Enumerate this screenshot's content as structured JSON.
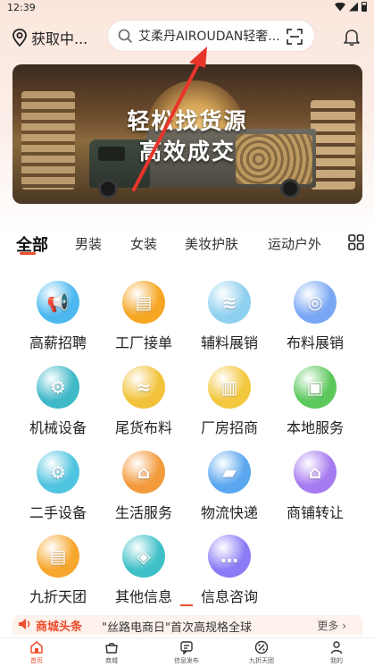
{
  "status_bar": {
    "time": "12:39"
  },
  "header": {
    "location": "获取中...",
    "search_text": "艾柔丹AIROUDAN轻奢..."
  },
  "banner": {
    "line1": "轻松找货源",
    "line2": "高效成交"
  },
  "tabs": [
    {
      "label": "全部"
    },
    {
      "label": "男装"
    },
    {
      "label": "女装"
    },
    {
      "label": "美妆护肤"
    },
    {
      "label": "运动户外"
    }
  ],
  "categories": [
    {
      "label": "高薪招聘",
      "icon": "megaphone-icon",
      "color": "#4db8f0"
    },
    {
      "label": "工厂接单",
      "icon": "document-icon",
      "color": "#f5a623"
    },
    {
      "label": "辅料展销",
      "icon": "fabric-layers-icon",
      "color": "#8fd0f0"
    },
    {
      "label": "布料展销",
      "icon": "cloth-roll-icon",
      "color": "#7aa7f5"
    },
    {
      "label": "机械设备",
      "icon": "gear-machine-icon",
      "color": "#3fb8c8"
    },
    {
      "label": "尾货布料",
      "icon": "fabric-wave-icon",
      "color": "#f2c23a"
    },
    {
      "label": "厂房招商",
      "icon": "factory-icon",
      "color": "#f3c83e"
    },
    {
      "label": "本地服务",
      "icon": "computer-service-icon",
      "color": "#5cc85c"
    },
    {
      "label": "二手设备",
      "icon": "machine-icon",
      "color": "#4fc4e0"
    },
    {
      "label": "生活服务",
      "icon": "shop-icon",
      "color": "#f39a3c"
    },
    {
      "label": "物流快递",
      "icon": "truck-icon",
      "color": "#5aa6ef"
    },
    {
      "label": "商铺转让",
      "icon": "store-icon",
      "color": "#a67af0"
    },
    {
      "label": "九折天团",
      "icon": "coupon-icon",
      "color": "#f7a72e"
    },
    {
      "label": "其他信息",
      "icon": "other-info-icon",
      "color": "#3fc0c8"
    },
    {
      "label": "信息咨询",
      "icon": "chat-icon",
      "color": "#8b7cf5"
    }
  ],
  "news": {
    "tag": "商城头条",
    "text": "\"丝路电商日\"首次高规格全球",
    "more": "更多 ›"
  },
  "bottom_nav": [
    {
      "label": "首页",
      "icon": "home-icon"
    },
    {
      "label": "商城",
      "icon": "shop-bag-icon"
    },
    {
      "label": "信息发布",
      "icon": "publish-icon"
    },
    {
      "label": "九折天团",
      "icon": "discount-icon"
    },
    {
      "label": "我的",
      "icon": "user-icon"
    }
  ],
  "colors": {
    "accent": "#ee4d2d",
    "arrow": "#e8352a"
  }
}
